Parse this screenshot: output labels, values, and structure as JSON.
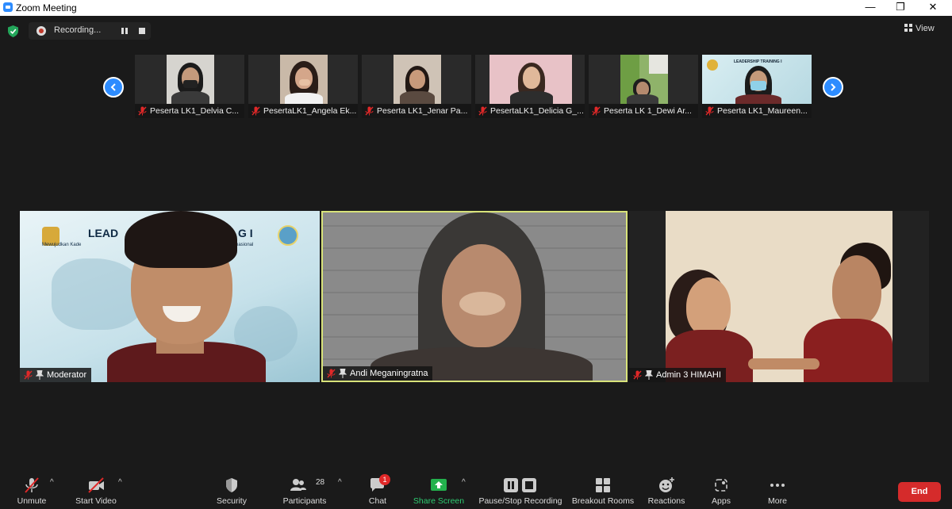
{
  "window": {
    "title": "Zoom Meeting",
    "minimize": "—",
    "maximize": "❐",
    "close": "✕"
  },
  "recording": {
    "label": "Recording..."
  },
  "view": {
    "label": "View"
  },
  "thumbnails": [
    {
      "name": "Peserta LK1_Delvia C..."
    },
    {
      "name": "PesertaLK1_Angela Ek..."
    },
    {
      "name": "Peserta LK1_Jenar Pa..."
    },
    {
      "name": "PesertaLK1_Delicia G_..."
    },
    {
      "name": "Peserta LK 1_Dewi Ar..."
    },
    {
      "name": "Peserta LK1_Maureen..."
    }
  ],
  "tiles": [
    {
      "name": "Moderator",
      "banner_title": "LEAD",
      "banner_title2": "G I",
      "banner_sub": "Mewujudkan Kade",
      "banner_sub2": "rnasional"
    },
    {
      "name": "Andi Meganingratna"
    },
    {
      "name": "Admin 3 HIMAHI"
    }
  ],
  "thumb_banner": "LEADERSHIP TRAINING I",
  "toolbar": {
    "unmute": "Unmute",
    "start_video": "Start Video",
    "security": "Security",
    "participants": "Participants",
    "participants_count": "28",
    "chat": "Chat",
    "chat_badge": "1",
    "share_screen": "Share Screen",
    "pause_stop_recording": "Pause/Stop Recording",
    "breakout_rooms": "Breakout Rooms",
    "reactions": "Reactions",
    "apps": "Apps",
    "more": "More",
    "end": "End"
  },
  "colors": {
    "accent": "#2d8cff",
    "active_speaker": "#d8e37a",
    "end": "#d52b2b",
    "share": "#2ecc71",
    "mic_off": "#e02828"
  }
}
